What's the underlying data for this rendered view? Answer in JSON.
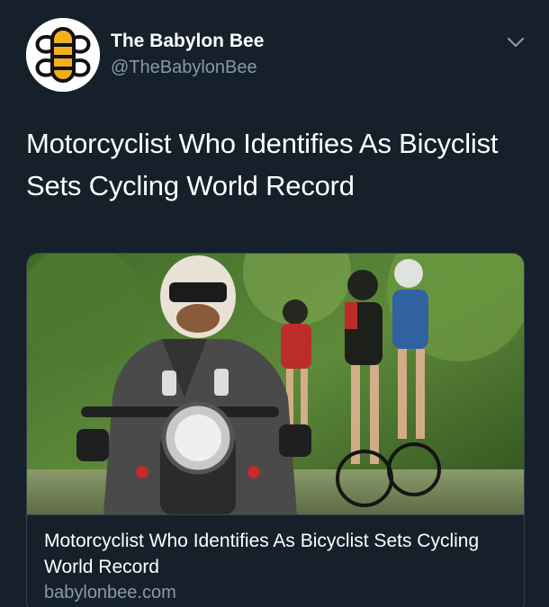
{
  "account": {
    "display_name": "The Babylon Bee",
    "handle": "@TheBabylonBee",
    "avatar_icon": "babylon-bee-logo"
  },
  "tweet": {
    "text": "Motorcyclist Who Identifies As Bicyclist Sets Cycling World Record"
  },
  "card": {
    "image_description_icon": "motorcyclist-with-cyclists-photo",
    "title": "Motorcyclist Who Identifies As Bicyclist Sets Cycling World Record",
    "domain": "babylonbee.com"
  },
  "colors": {
    "background": "#15202b",
    "text": "#ffffff",
    "secondary_text": "#8899a6",
    "border": "#38444d",
    "logo_yellow": "#f2b01e"
  }
}
